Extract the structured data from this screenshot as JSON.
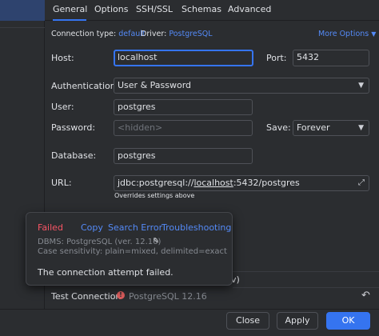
{
  "tabs": [
    {
      "label": "General",
      "active": true
    },
    {
      "label": "Options",
      "active": false
    },
    {
      "label": "SSH/SSL",
      "active": false
    },
    {
      "label": "Schemas",
      "active": false
    },
    {
      "label": "Advanced",
      "active": false
    }
  ],
  "connection_info": {
    "type_label": "Connection type:",
    "type_value": "default",
    "driver_label": "Driver:",
    "driver_value": "PostgreSQL",
    "more_options": "More Options",
    "more_options_icon": "chevron-down-icon"
  },
  "form": {
    "host_label": "Host:",
    "host_value": "localhost",
    "port_label": "Port:",
    "port_value": "5432",
    "auth_label": "Authentication:",
    "auth_value": "User & Password",
    "user_label": "User:",
    "user_value": "postgres",
    "password_label": "Password:",
    "password_placeholder": "<hidden>",
    "save_label": "Save:",
    "save_value": "Forever",
    "database_label": "Database:",
    "database_value": "postgres",
    "url_label": "URL:",
    "url_prefix": "jdbc:postgresql://",
    "url_host": "localhost",
    "url_suffix": ":5432/postgres",
    "url_note": "Overrides settings above"
  },
  "popup": {
    "status": "Failed",
    "copy": "Copy",
    "search_error": "Search Error",
    "troubleshooting": "Troubleshooting",
    "dbms": "DBMS: PostgreSQL (ver. 12.16)",
    "case_sensitivity": "Case sensitivity: plain=mixed, delimited=exact",
    "message": "The connection attempt failed."
  },
  "partial_text": "v)",
  "test_connection": {
    "label": "Test Connection",
    "status": "PostgreSQL 12.16"
  },
  "buttons": {
    "close": "Close",
    "apply": "Apply",
    "ok": "OK"
  },
  "colors": {
    "accent": "#3574f0",
    "link": "#548af7",
    "error": "#f75464",
    "background": "#2b2d30"
  }
}
